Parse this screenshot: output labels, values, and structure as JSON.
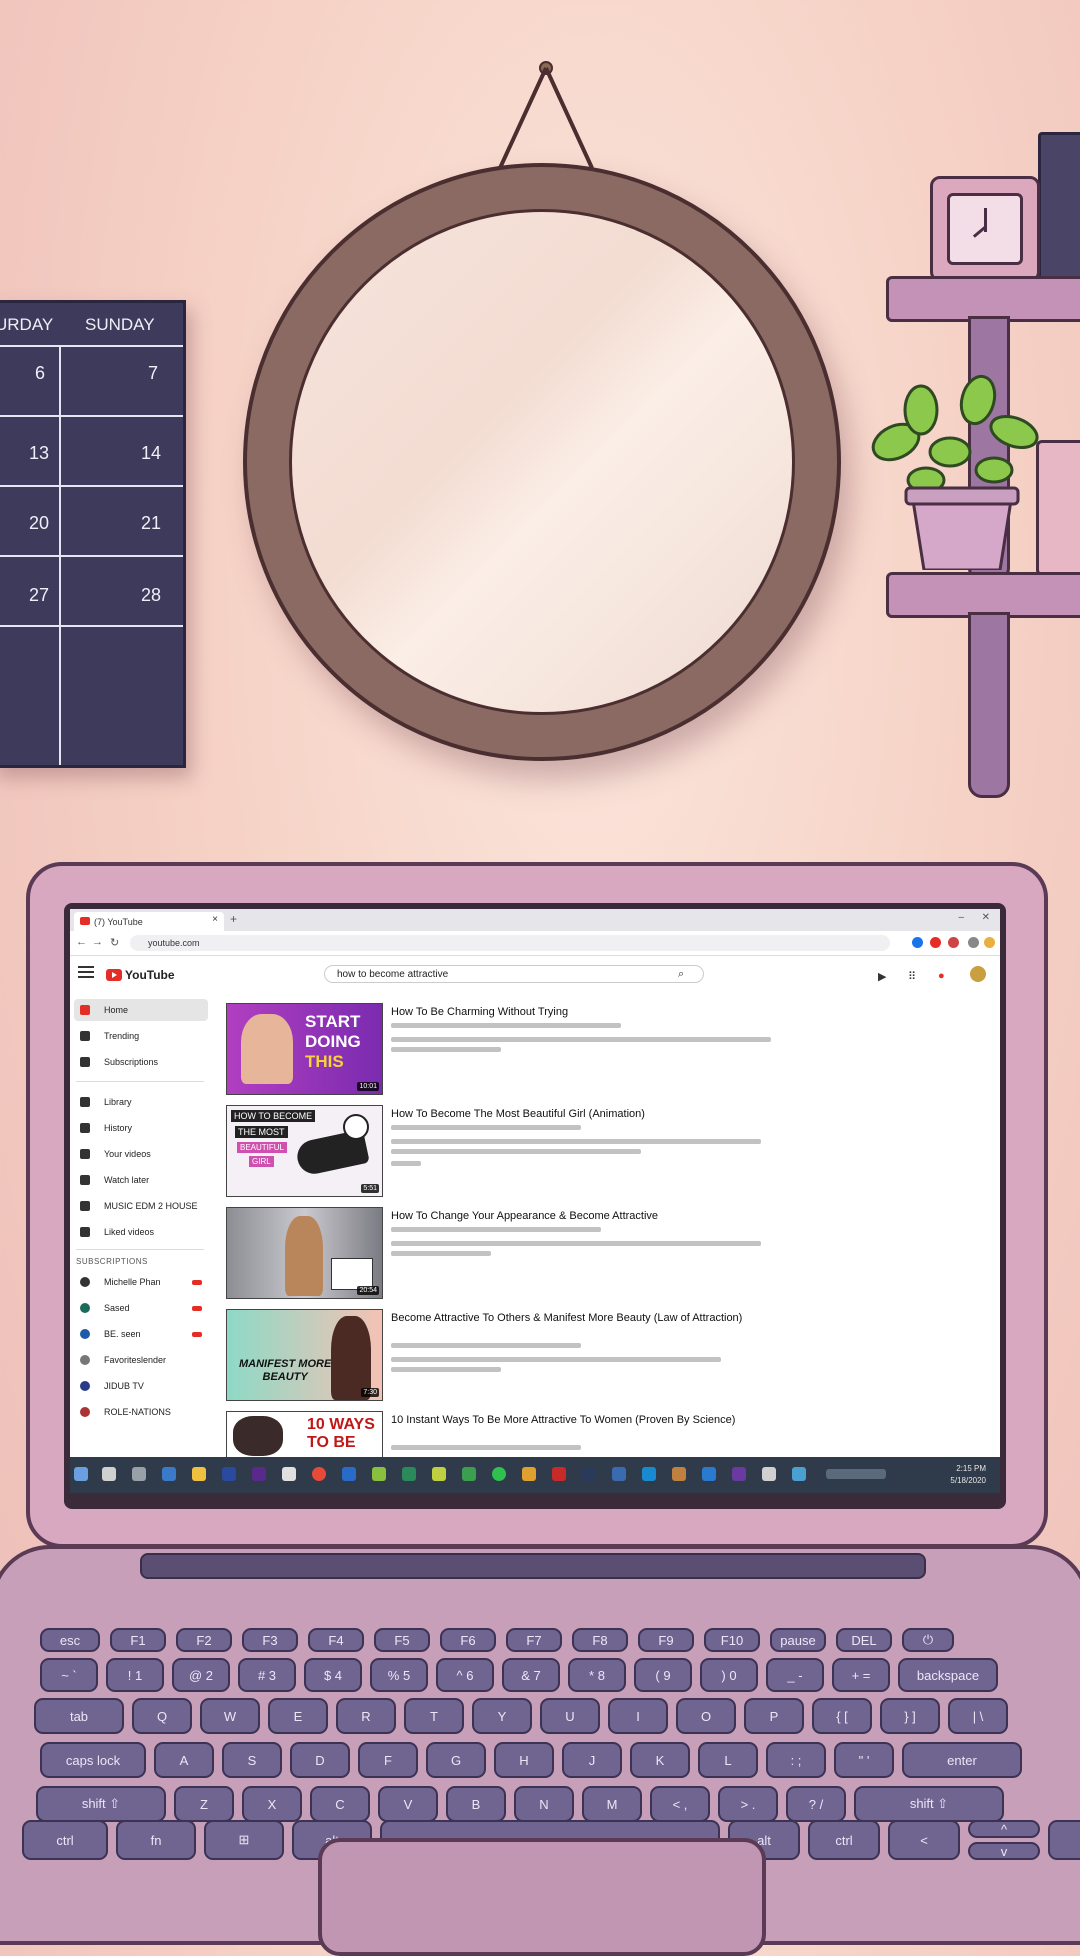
{
  "calendar": {
    "days": [
      "URDAY",
      "SUNDAY"
    ],
    "saturday": [
      "6",
      "13",
      "20",
      "27"
    ],
    "sunday": [
      "7",
      "14",
      "21",
      "28"
    ]
  },
  "browser": {
    "tab_title": "(7) YouTube",
    "url": "youtube.com",
    "search_query": "how to become attractive"
  },
  "youtube": {
    "logo": "YouTube",
    "sidebar": {
      "main": [
        "Home",
        "Trending",
        "Subscriptions"
      ],
      "library": [
        "Library",
        "History",
        "Your videos",
        "Watch later",
        "MUSIC EDM 2 HOUSE",
        "Liked videos"
      ],
      "subscriptions_title": "SUBSCRIPTIONS",
      "subscriptions": [
        "Michelle Phan",
        "Sased",
        "BE. seen",
        "Favoriteslender",
        "JIDUB TV",
        "ROLE-NATIONS"
      ]
    },
    "videos": [
      {
        "title": "How To Be Charming Without Trying",
        "duration": "10:01",
        "thumb_text": [
          "START",
          "DOING",
          "THIS"
        ]
      },
      {
        "title": "How To Become The Most Beautiful Girl (Animation)",
        "duration": "5:51",
        "thumb_text": [
          "HOW TO BECOME",
          "THE MOST",
          "BEAUTIFUL",
          "GIRL"
        ]
      },
      {
        "title": "How To Change Your Appearance & Become Attractive",
        "duration": "20:54",
        "thumb_text": []
      },
      {
        "title": "Become Attractive To Others & Manifest More Beauty (Law of Attraction)",
        "duration": "7:30",
        "thumb_text": [
          "MANIFEST MORE",
          "BEAUTY"
        ]
      },
      {
        "title": "10 Instant Ways To Be More Attractive To Women (Proven By Science)",
        "duration": "",
        "thumb_text": [
          "10 WAYS",
          "TO BE"
        ]
      }
    ]
  },
  "taskbar": {
    "time": "2:15 PM",
    "date": "5/18/2020"
  },
  "keyboard": {
    "row1": [
      "esc",
      "F1",
      "F2",
      "F3",
      "F4",
      "F5",
      "F6",
      "F7",
      "F8",
      "F9",
      "F10",
      "pause",
      "DEL",
      "⏻"
    ],
    "row2": [
      "~ `",
      "! 1",
      "@ 2",
      "# 3",
      "$ 4",
      "% 5",
      "^ 6",
      "& 7",
      "* 8",
      "( 9",
      ") 0",
      "_ -",
      "+ =",
      "backspace"
    ],
    "row3": [
      "tab",
      "Q",
      "W",
      "E",
      "R",
      "T",
      "Y",
      "U",
      "I",
      "O",
      "P",
      "{ [",
      "} ]",
      "| \\"
    ],
    "row4": [
      "caps lock",
      "A",
      "S",
      "D",
      "F",
      "G",
      "H",
      "J",
      "K",
      "L",
      ": ;",
      "\" '",
      "enter"
    ],
    "row5": [
      "shift ⇧",
      "Z",
      "X",
      "C",
      "V",
      "B",
      "N",
      "M",
      "< ,",
      "> .",
      "? /",
      "shift ⇧"
    ],
    "row6": [
      "ctrl",
      "fn",
      "⊞",
      "alt",
      "",
      "alt",
      "ctrl",
      "<",
      "^",
      "v",
      ">"
    ]
  },
  "colors": {
    "accent": "#e52d27",
    "wall": "#f6d2c6",
    "laptop": "#d8a7c0",
    "keys": "#6f6590"
  }
}
